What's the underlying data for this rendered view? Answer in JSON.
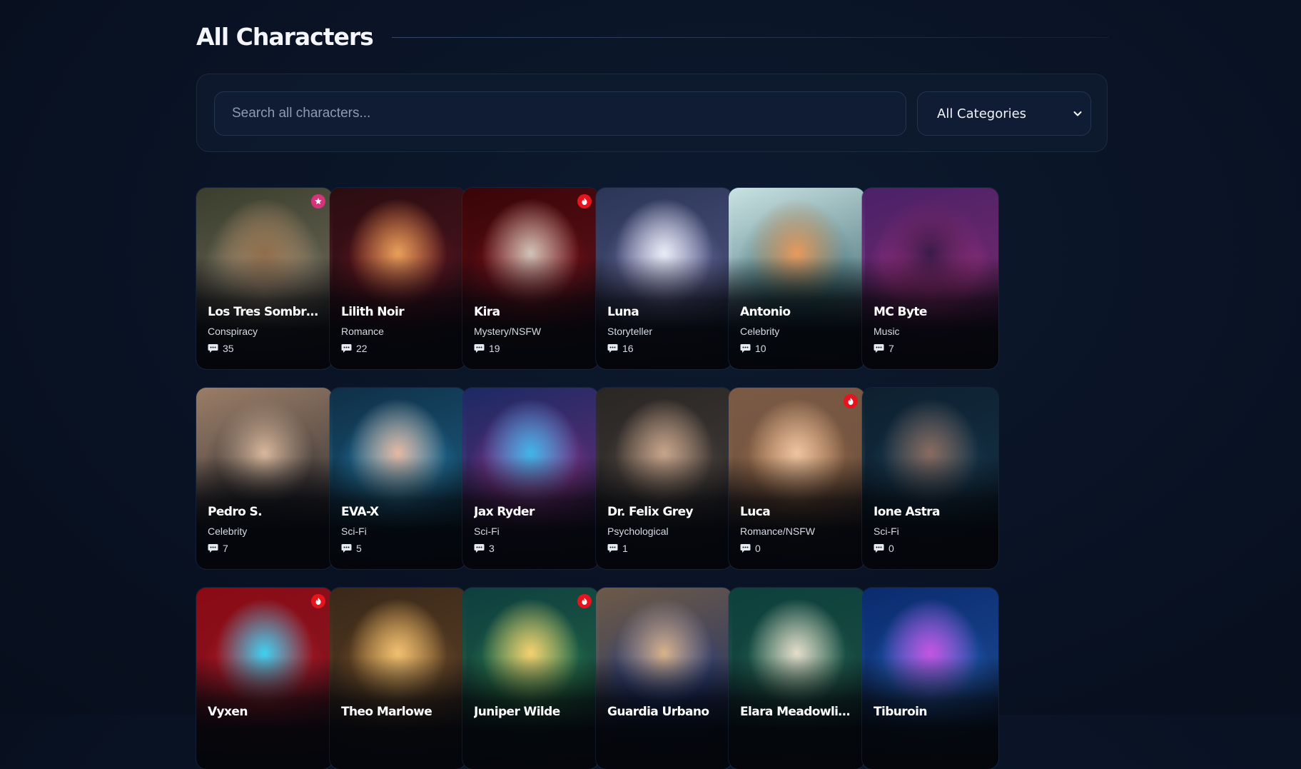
{
  "page": {
    "title": "All Characters"
  },
  "search": {
    "placeholder": "Search all characters..."
  },
  "filter": {
    "selected": "All Categories",
    "icon": "chevron-down-icon"
  },
  "icons": {
    "message": "chat-bubble-icon"
  },
  "characters": [
    {
      "name": "Los Tres Sombreros",
      "category": "Conspiracy",
      "messages": "35",
      "badge": "star",
      "theme": {
        "bg": "#3a3e2c",
        "accent": "#c7b493",
        "glow": "#8f6d4b"
      }
    },
    {
      "name": "Lilith Noir",
      "category": "Romance",
      "messages": "22",
      "badge": "",
      "theme": {
        "bg": "#2a0d10",
        "accent": "#8a1622",
        "glow": "#e8a05a"
      }
    },
    {
      "name": "Kira",
      "category": "Mystery/NSFW",
      "messages": "19",
      "badge": "fire",
      "theme": {
        "bg": "#3a0507",
        "accent": "#a3131a",
        "glow": "#d0c3b8"
      }
    },
    {
      "name": "Luna",
      "category": "Storyteller",
      "messages": "16",
      "badge": "",
      "theme": {
        "bg": "#2b3657",
        "accent": "#8c89c7",
        "glow": "#e9ecf5"
      }
    },
    {
      "name": "Antonio",
      "category": "Celebrity",
      "messages": "10",
      "badge": "",
      "theme": {
        "bg": "#c9e2e2",
        "accent": "#2a6e72",
        "glow": "#e79a5e"
      }
    },
    {
      "name": "MC Byte",
      "category": "Music",
      "messages": "7",
      "badge": "",
      "theme": {
        "bg": "#4a2168",
        "accent": "#d43a9a",
        "glow": "#3b1b48"
      }
    },
    {
      "name": "Pedro S.",
      "category": "Celebrity",
      "messages": "7",
      "badge": "",
      "theme": {
        "bg": "#9a7d67",
        "accent": "#2c2a2c",
        "glow": "#d9b89c"
      }
    },
    {
      "name": "EVA-X",
      "category": "Sci-Fi",
      "messages": "5",
      "badge": "",
      "theme": {
        "bg": "#0f2f47",
        "accent": "#2ea4d9",
        "glow": "#e3b9a4"
      }
    },
    {
      "name": "Jax Ryder",
      "category": "Sci-Fi",
      "messages": "3",
      "badge": "",
      "theme": {
        "bg": "#1c2a63",
        "accent": "#c23fb2",
        "glow": "#3fb6e8"
      }
    },
    {
      "name": "Dr. Felix Grey",
      "category": "Psychological",
      "messages": "1",
      "badge": "",
      "theme": {
        "bg": "#2a2624",
        "accent": "#6b5c4d",
        "glow": "#c7a48b"
      }
    },
    {
      "name": "Luca",
      "category": "Romance/NSFW",
      "messages": "0",
      "badge": "fire",
      "theme": {
        "bg": "#7a5a45",
        "accent": "#b17748",
        "glow": "#eec4a0"
      }
    },
    {
      "name": "Ione Astra",
      "category": "Sci-Fi",
      "messages": "0",
      "badge": "",
      "theme": {
        "bg": "#0d2030",
        "accent": "#1e4b63",
        "glow": "#8a6b60"
      }
    },
    {
      "name": "Vyxen",
      "category": "",
      "messages": "",
      "badge": "fire",
      "theme": {
        "bg": "#8a0a14",
        "accent": "#d7222e",
        "glow": "#3fd0f0"
      }
    },
    {
      "name": "Theo Marlowe",
      "category": "",
      "messages": "",
      "badge": "",
      "theme": {
        "bg": "#3a2818",
        "accent": "#a06a30",
        "glow": "#f0c070"
      }
    },
    {
      "name": "Juniper Wilde",
      "category": "",
      "messages": "",
      "badge": "fire",
      "theme": {
        "bg": "#0e3f3f",
        "accent": "#3aa35a",
        "glow": "#f5d070"
      }
    },
    {
      "name": "Guardia Urbano",
      "category": "",
      "messages": "",
      "badge": "",
      "theme": {
        "bg": "#6d5a48",
        "accent": "#1c3fa0",
        "glow": "#d9b28a"
      }
    },
    {
      "name": "Elara Meadowlight",
      "category": "",
      "messages": "",
      "badge": "",
      "theme": {
        "bg": "#0d3f3c",
        "accent": "#2f7d5c",
        "glow": "#e5dccb"
      }
    },
    {
      "name": "Tiburoin",
      "category": "",
      "messages": "",
      "badge": "",
      "theme": {
        "bg": "#0b2b6e",
        "accent": "#2d7ef0",
        "glow": "#c455e0"
      }
    }
  ]
}
